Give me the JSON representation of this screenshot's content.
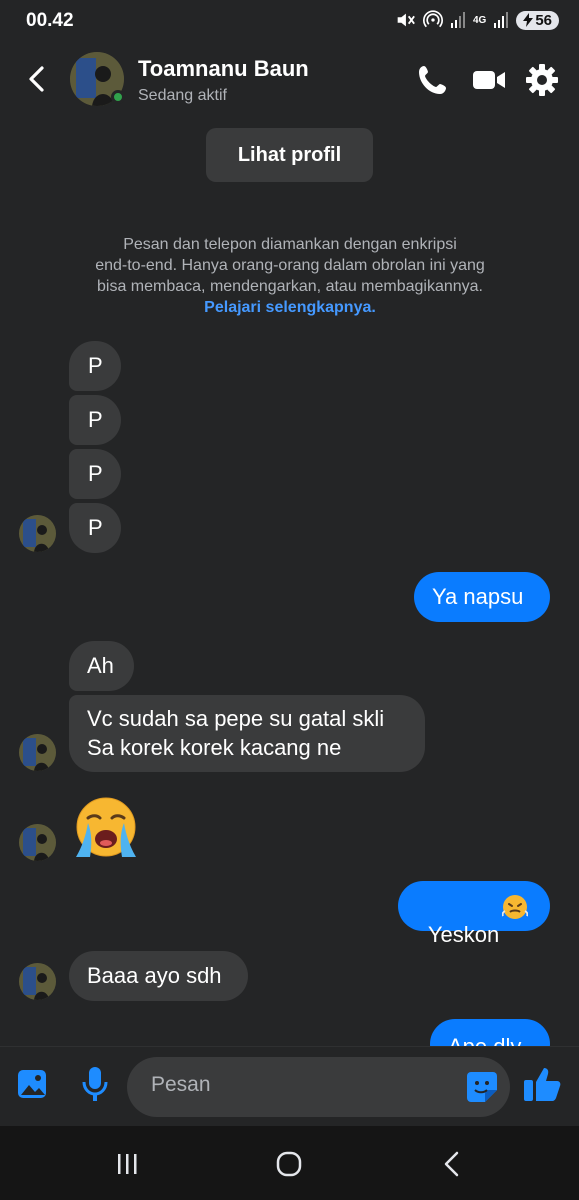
{
  "status_bar": {
    "time": "00.42",
    "network": "4G",
    "battery": "56"
  },
  "header": {
    "contact_name": "Toamnanu Baun",
    "contact_status": "Sedang aktif"
  },
  "profile_button": "Lihat profil",
  "encryption_notice": {
    "line1": "Pesan dan telepon diamankan dengan enkripsi",
    "line2": "end-to-end. Hanya orang-orang dalam obrolan ini yang",
    "line3": "bisa membaca, mendengarkan, atau membagikannya.",
    "link": "Pelajari selengkapnya."
  },
  "messages": [
    {
      "sender": "contact",
      "text": "P"
    },
    {
      "sender": "contact",
      "text": "P"
    },
    {
      "sender": "contact",
      "text": "P"
    },
    {
      "sender": "contact",
      "text": "P"
    },
    {
      "sender": "me",
      "text": "Ya napsu"
    },
    {
      "sender": "contact",
      "text": "Ah"
    },
    {
      "sender": "contact",
      "text": "Vc sudah sa pepe su gatal skli\nSa korek korek kacang ne"
    },
    {
      "sender": "contact",
      "emoji": "loudly-crying-face"
    },
    {
      "sender": "me",
      "text": "Yeskon",
      "emoji": "face-with-steam-from-nose"
    },
    {
      "sender": "contact",
      "text": "Baaa ayo sdh"
    },
    {
      "sender": "me",
      "text": "Ape dly"
    }
  ],
  "composer": {
    "placeholder": "Pesan"
  },
  "colors": {
    "background": "#242526",
    "incoming_bubble": "#3a3b3c",
    "outgoing_bubble": "#0a7cff",
    "accent": "#1e8cff",
    "online": "#31a24c"
  }
}
